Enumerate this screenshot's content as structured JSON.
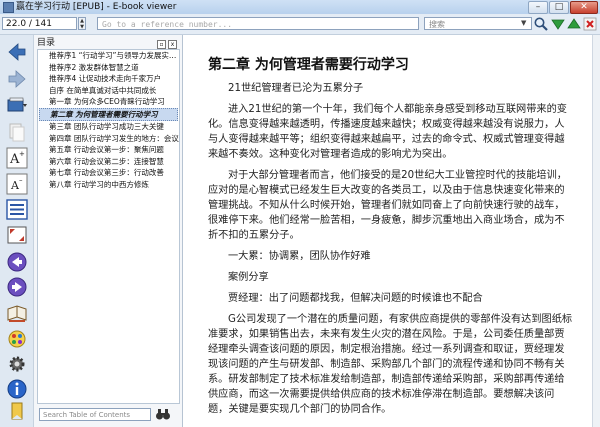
{
  "window": {
    "title": "赢在学习行动 [EPUB] - E-book viewer",
    "minimize": "–",
    "maximize": "□",
    "close": "✕"
  },
  "toolbar": {
    "position_value": "22.0 / 141",
    "reference_placeholder": "Go to a reference number...",
    "search_placeholder": "搜索",
    "search_dropdown": "▼",
    "icons": [
      "search-icon",
      "arrow-down-icon",
      "arrow-up-icon",
      "close-icon"
    ]
  },
  "left_toolbar": {
    "icons": [
      "back-arrow-icon",
      "forward-arrow-icon",
      "open-book-icon",
      "copy-icon",
      "font-larger-icon",
      "font-smaller-icon",
      "toc-icon",
      "fullscreen-icon",
      "previous-page-icon",
      "next-page-icon",
      "library-icon",
      "theme-icon",
      "preferences-icon",
      "info-icon",
      "bookmark-icon"
    ]
  },
  "toc": {
    "header": "目录",
    "items": [
      "推荐序1 “行动学习”与领导力发展实…",
      "推荐序2 激发群体智慧之道",
      "推荐序4 让促动技术走向千家万户",
      "自序 在简单真诚对话中共同成长",
      "第一章 为何众多CEO青睐行动学习",
      "第二章 为何管理者需要行动学习",
      "第三章 团队行动学习成功三大关键",
      "第四章 团队行动学习发生的地方：会议室",
      "第五章 行动会议第一步：聚焦问题",
      "第六章 行动会议第二步：连接智慧",
      "第七章 行动会议第三步：行动改善",
      "第八章 行动学习的中西方修炼"
    ],
    "selected_index": 5,
    "search_placeholder": "Search Table of Contents"
  },
  "reader": {
    "chapter_title": "第二章 为何管理者需要行动学习",
    "paragraphs": [
      "21世纪管理者已沦为五累分子",
      "进入21世纪的第一个十年，我们每个人都能亲身感受到移动互联网带来的变化。信息变得越来越透明，传播速度越来越快；权威变得越来越没有说服力，人与人变得越来越平等；组织变得越来越扁平，过去的命令式、权威式管理变得越来越不奏效。这种变化对管理者造成的影响尤为突出。",
      "对于大部分管理者而言，他们接受的是20世纪大工业管控时代的技能培训，应对的是心智模式已经发生巨大改变的各类员工，以及由于信息快速变化带来的管理挑战。不知从什么时候开始，管理者们就如同奋上了向前快速行驶的战车，很难停下来。他们经常一脸苦相，一身疲惫，脚步沉重地出入商业场合，成为不折不扣的五累分子。",
      "一大累：协调累，团队协作好难",
      "案例分享",
      "贾经理：出了问题都找我，但解决问题的时候谁也不配合",
      "G公司发现了一个潜在的质量问题，有家供应商提供的零部件没有达到图纸标准要求，如果销售出去，未来有发生火灾的潜在风险。于是，公司委任质量部贾经理牵头调查该问题的原因，制定根治措施。经过一系列调查和取证，贾经理发现该问题的产生与研发部、制造部、采购部几个部门的流程传递和协同不畅有关系。研发部制定了技术标准发给制造部，制造部传递给采购部，采购部再传递给供应商，而这一次需要提供给供应商的技术标准停滞在制造部。要想解决该问题，关键是要实现几个部门的协同合作。"
    ]
  }
}
